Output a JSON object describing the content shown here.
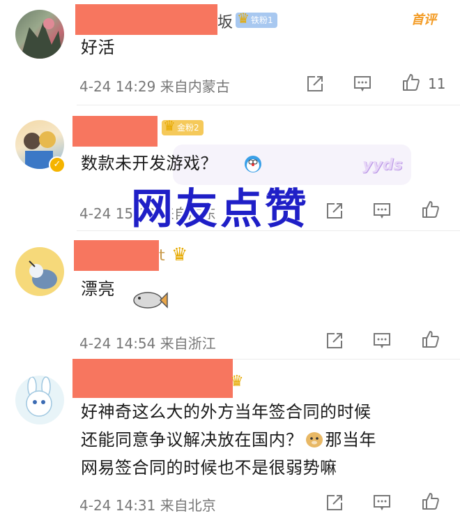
{
  "comments": [
    {
      "name_fragment": "坂",
      "badge": "铁粉1",
      "badge_level": "2",
      "tag": "首评",
      "text": "好活",
      "time": "4-24 14:29",
      "location": "来自内蒙古",
      "likes": "11"
    },
    {
      "badge": "金粉2",
      "badge_level": "7",
      "text": "数款未开发游戏？",
      "time": "4-24 15:02",
      "location": "来自广东"
    },
    {
      "name_fragment": "t",
      "text": "漂亮",
      "time": "4-24 14:54",
      "location": "来自浙江"
    },
    {
      "badge_level": "6",
      "text_lines": [
        "好神奇这么大的外方当年签合同的时候",
        "还能同意争议解决放在国内？",
        "网易签合同的时候也不是很弱势嘛"
      ],
      "text_line2_suffix": "那当年",
      "time": "4-24 14:31",
      "location": "来自北京"
    }
  ],
  "overlay": {
    "text": "网友点赞",
    "sticker": "yyds"
  },
  "colors": {
    "redaction": "#f7765f",
    "overlay_text": "#1f1fc7",
    "first_comment_tag": "#f39c26"
  },
  "icons": [
    "share-icon",
    "comment-icon",
    "like-icon",
    "crown-icon"
  ]
}
